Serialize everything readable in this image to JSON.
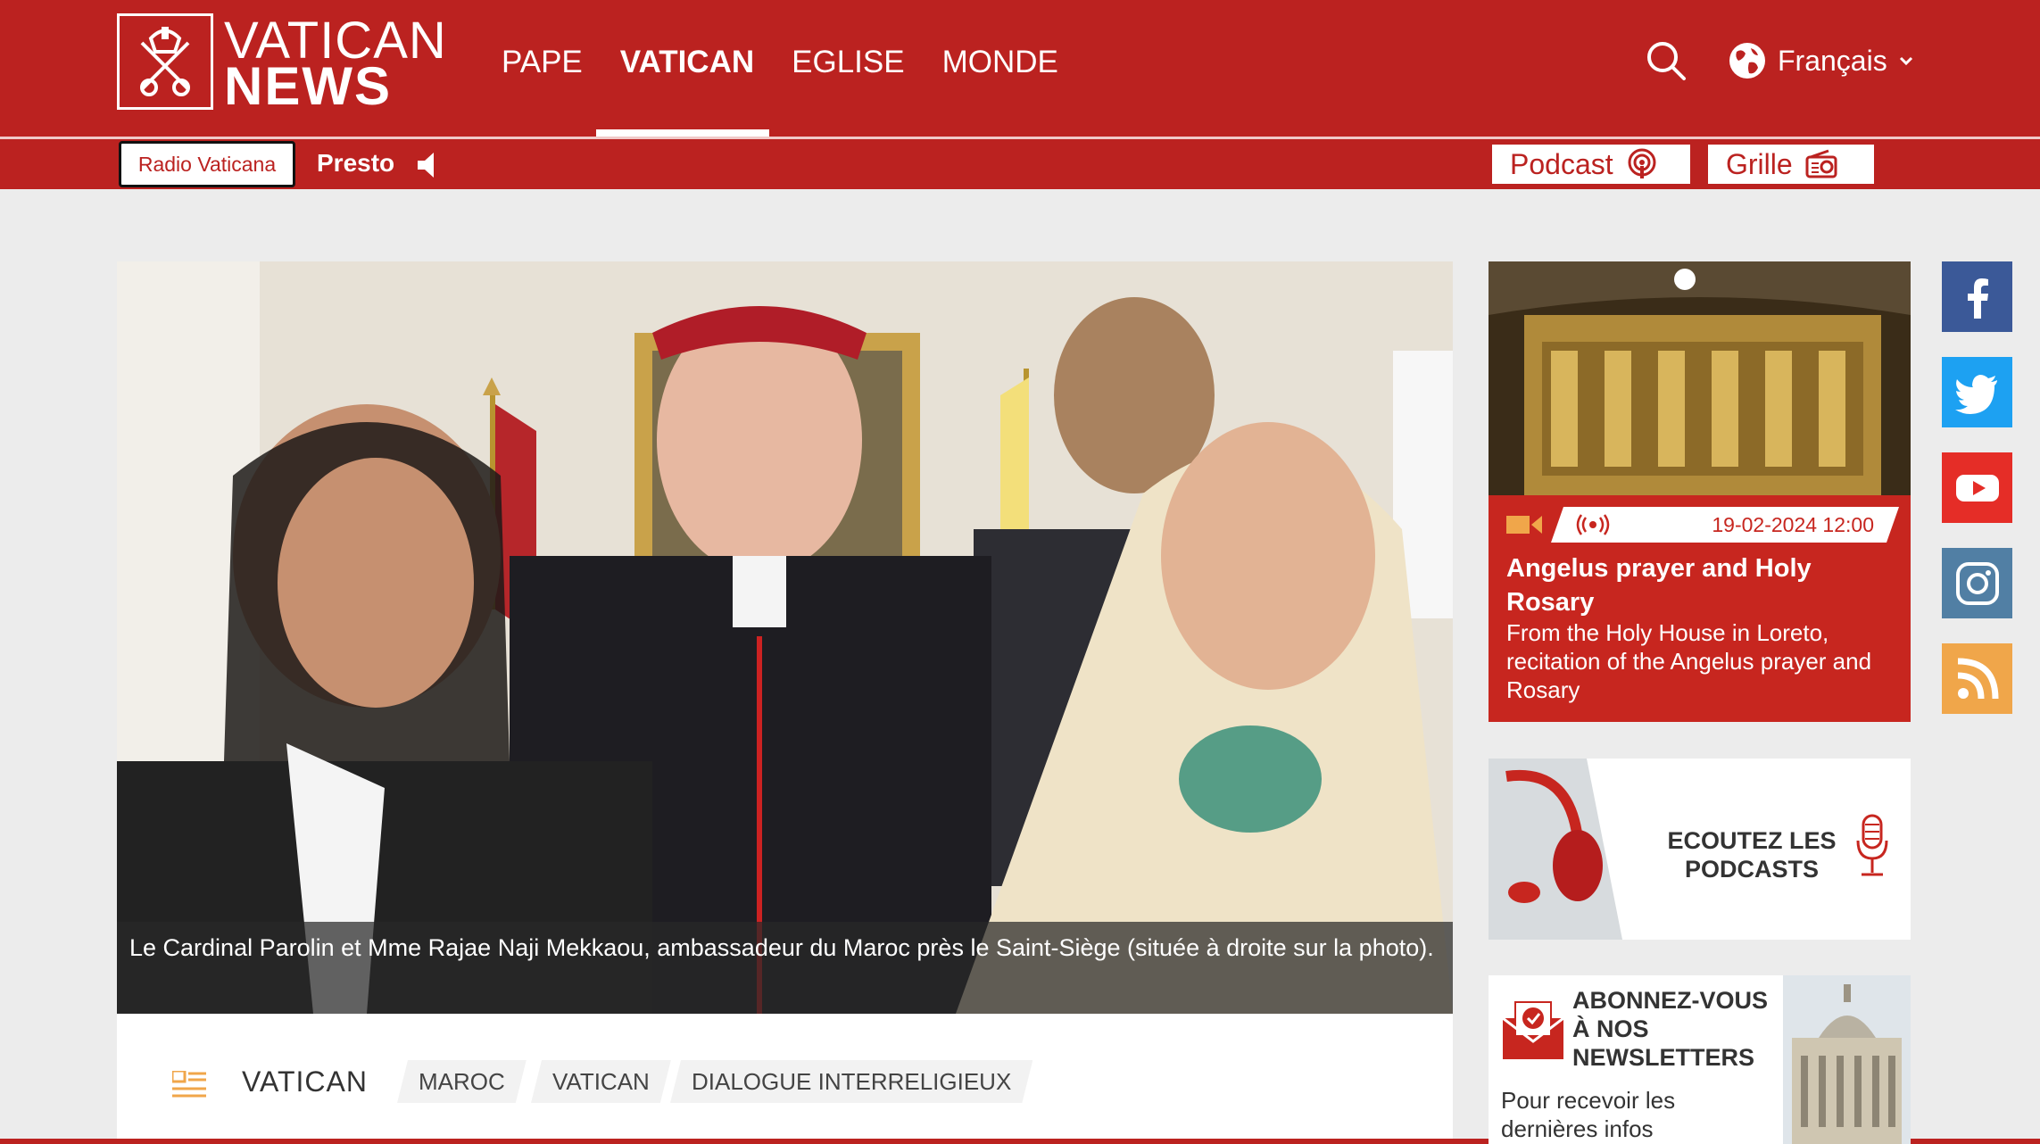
{
  "header": {
    "logo_top": "VATICAN",
    "logo_bottom": "NEWS",
    "nav": [
      "PAPE",
      "VATICAN",
      "EGLISE",
      "MONDE"
    ],
    "language": "Français",
    "radio_button": "Radio Vaticana",
    "presto": "Presto",
    "podcast": "Podcast",
    "grille": "Grille"
  },
  "article": {
    "caption": "Le Cardinal Parolin et Mme Rajae Naji Mekkaou, ambassadeur du Maroc près le Saint-Siège (située à droite sur la photo).",
    "section": "VATICAN",
    "tags": [
      "MAROC",
      "VATICAN",
      "DIALOGUE INTERRELIGIEUX"
    ]
  },
  "sidebar": {
    "live": {
      "date": "19-02-2024 12:00",
      "title": "Angelus prayer and Holy Rosary",
      "description": "From the Holy House in Loreto, recitation of the Angelus prayer and Rosary"
    },
    "podcasts": "ECOUTEZ LES PODCASTS",
    "newsletter": {
      "title": "ABONNEZ-VOUS À NOS NEWSLETTERS",
      "description": "Pour recevoir les dernières infos"
    }
  },
  "social": [
    "facebook-icon",
    "twitter-icon",
    "youtube-icon",
    "instagram-icon",
    "rss-icon"
  ],
  "colors": {
    "brand_red": "#bb2220",
    "facebook": "#3b5998",
    "twitter": "#1da1f2",
    "youtube": "#e52d27",
    "instagram": "#517fa4",
    "rss": "#f0a64a"
  }
}
